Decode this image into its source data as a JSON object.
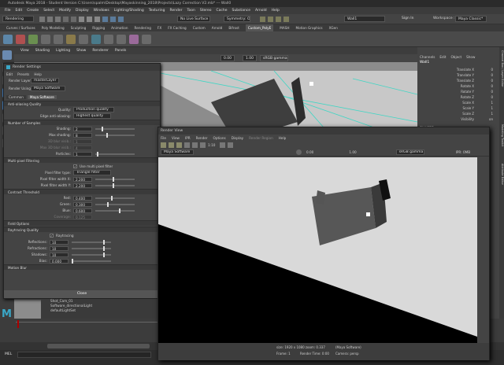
{
  "window": {
    "title": "Autodesk Maya 2018 - Student Version C:\\Users\\spalm\\Desktop\\Mayaskinning_2018\\Projects\\Lazy Correction V2.mb* --- Wall0"
  },
  "menubar": [
    "File",
    "Edit",
    "Create",
    "Select",
    "Modify",
    "Display",
    "Windows",
    "Lighting/Shading",
    "Texturing",
    "Render",
    "Toon",
    "Stereo",
    "Cache",
    "Substance",
    "Arnold",
    "Help"
  ],
  "status": {
    "mode": "Rendering",
    "no_live_surface": "No Live Surface",
    "symmetry": "Symmetry: Off",
    "search_value": "Wall1",
    "signin": "Sign In",
    "workspace_label": "Workspace :",
    "workspace_value": "Maya Classic*"
  },
  "shelf_tabs": [
    "Curves / Surfaces",
    "Poly Modeling",
    "Sculpting",
    "Rigging",
    "Animation",
    "Rendering",
    "FX",
    "FX Caching",
    "Custom",
    "Arnold",
    "Bifrost",
    "Custom_PolyE",
    "MASH",
    "Motion Graphics",
    "XGen"
  ],
  "shelf_active": "Custom_PolyE",
  "viewport": {
    "menu": [
      "View",
      "Shading",
      "Lighting",
      "Show",
      "Renderer",
      "Panels"
    ],
    "coord1": "0.00",
    "coord2": "1.00",
    "gamma": "sRGB gamma"
  },
  "channel_box": {
    "tabs": [
      "Channels",
      "Edit",
      "Object",
      "Show"
    ],
    "object": "Wall1",
    "attrs": [
      {
        "name": "Translate X",
        "value": "0"
      },
      {
        "name": "Translate Y",
        "value": "0"
      },
      {
        "name": "Translate Z",
        "value": "0"
      },
      {
        "name": "Rotate X",
        "value": "0"
      },
      {
        "name": "Rotate Y",
        "value": "0"
      },
      {
        "name": "Rotate Z",
        "value": "0"
      },
      {
        "name": "Scale X",
        "value": "1"
      },
      {
        "name": "Scale Y",
        "value": "1"
      },
      {
        "name": "Scale Z",
        "value": "1"
      },
      {
        "name": "Visibility",
        "value": "on"
      }
    ],
    "shapes_label": "SHAPES",
    "shape_name": "Wall1Shape",
    "side_tabs": [
      "Channel Box / Layer Editor",
      "Modeling Toolkit",
      "Attribute Editor"
    ]
  },
  "render_settings": {
    "title": "Render Settings",
    "menu": [
      "Edit",
      "Presets",
      "Help"
    ],
    "render_layer_label": "Render Layer",
    "render_layer_value": "masterLayer",
    "render_using_label": "Render Using",
    "render_using_value": "Maya Software",
    "tabs": [
      "Common",
      "Maya Software"
    ],
    "sections": {
      "aa": "Anti-aliasing Quality",
      "samples": "Number of Samples",
      "mpf": "Multi-pixel Filtering",
      "contrast": "Contrast Threshold",
      "field": "Field Options",
      "ray": "Raytracing Quality",
      "motion": "Motion Blur"
    },
    "quality_label": "Quality:",
    "quality_value": "Production quality",
    "edge_label": "Edge anti-aliasing:",
    "edge_value": "Highest quality",
    "shading_label": "Shading:",
    "shading_value": "2",
    "maxshading_label": "Max shading:",
    "maxshading_value": "8",
    "blur3d_label": "3D blur visib.:",
    "blur3d_value": "1",
    "maxblur3d_label": "Max 3D blur visib.:",
    "maxblur3d_value": "4",
    "particles_label": "Particles:",
    "particles_value": "1",
    "use_mpf": "Use multi pixel filter",
    "filter_type_label": "Pixel filter type:",
    "filter_type_value": "Triangle filter",
    "fwx_label": "Pixel filter width X:",
    "fwx_value": "2.200",
    "fwy_label": "Pixel filter width Y:",
    "fwy_value": "2.200",
    "red_label": "Red:",
    "red_value": "0.400",
    "green_label": "Green:",
    "green_value": "0.300",
    "blue_label": "Blue:",
    "blue_value": "0.600",
    "coverage_label": "Coverage:",
    "coverage_value": "0.125",
    "raytracing": "Raytracing",
    "refl_label": "Reflections:",
    "refl_value": "10",
    "refr_label": "Refractions:",
    "refr_value": "10",
    "shadows_label": "Shadows:",
    "shadows_value": "10",
    "bias_label": "Bias:",
    "bias_value": "0.000",
    "close": "Close"
  },
  "outliner": [
    "Shot_Cam_01",
    "Software_directionalLight",
    "defaultLightSet"
  ],
  "render_view": {
    "title": "Render View",
    "menu": [
      "File",
      "View",
      "IPR",
      "Render",
      "Options",
      "Display",
      "Render Region",
      "Help"
    ],
    "renderer": "Maya Software",
    "ratio": "1:10",
    "val1": "0.00",
    "val2": "1.00",
    "gamma": "sRGB gamma",
    "ipr": "IPR: 0MB",
    "info_size": "size: 1920 x 1080 zoom: 0.337",
    "info_renderer": "(Maya Software)",
    "frame": "Frame: 1",
    "render_time": "Render Time: 0:00",
    "camera": "Camera: persp"
  },
  "mel_label": "MEL"
}
